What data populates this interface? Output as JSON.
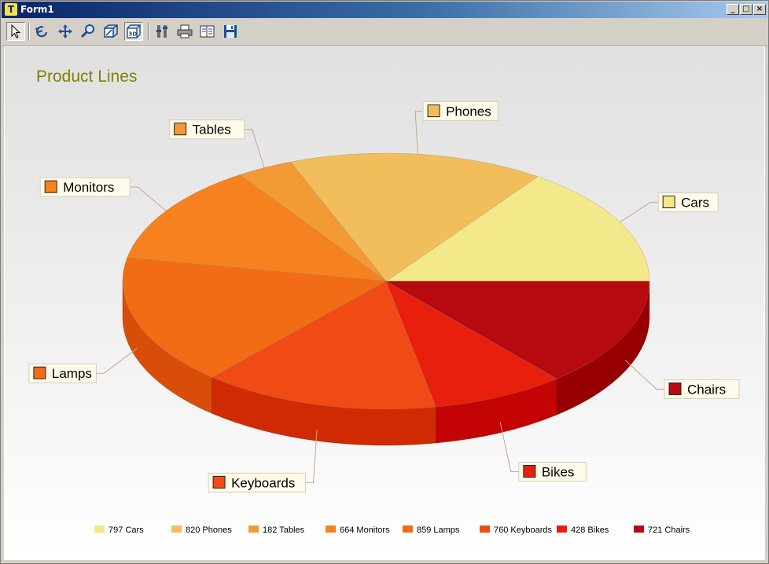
{
  "window": {
    "title": "Form1",
    "minimize": "_",
    "maximize": "□",
    "close": "×"
  },
  "toolbar": {
    "buttons": [
      {
        "name": "pointer-icon"
      },
      {
        "name": "rotate-icon"
      },
      {
        "name": "move-icon"
      },
      {
        "name": "zoom-icon"
      },
      {
        "name": "depth-icon"
      },
      {
        "name": "3d-icon"
      },
      {
        "name": "edit-icon"
      },
      {
        "name": "print-icon"
      },
      {
        "name": "copy-icon"
      },
      {
        "name": "save-icon"
      }
    ]
  },
  "chart_data": {
    "type": "pie",
    "title": "Product Lines",
    "categories": [
      "Cars",
      "Phones",
      "Tables",
      "Monitors",
      "Lamps",
      "Keyboards",
      "Bikes",
      "Chairs"
    ],
    "values": [
      797,
      820,
      182,
      664,
      859,
      760,
      428,
      721
    ],
    "colors": [
      "#f3e88a",
      "#f2be5c",
      "#f29a34",
      "#f5821f",
      "#f26c16",
      "#f04b14",
      "#e81f0c",
      "#b60a10"
    ],
    "side_colors": [
      "#d8c860",
      "#d9a03a",
      "#d97a1a",
      "#d96410",
      "#d84e08",
      "#d02a02",
      "#c40404",
      "#960003"
    ],
    "legend": [
      "797 Cars",
      "820 Phones",
      "182 Tables",
      "664 Monitors",
      "859 Lamps",
      "760 Keyboards",
      "428 Bikes",
      "721 Chairs"
    ],
    "legend_position": "bottom",
    "marks_labels": true,
    "three_d": true
  }
}
